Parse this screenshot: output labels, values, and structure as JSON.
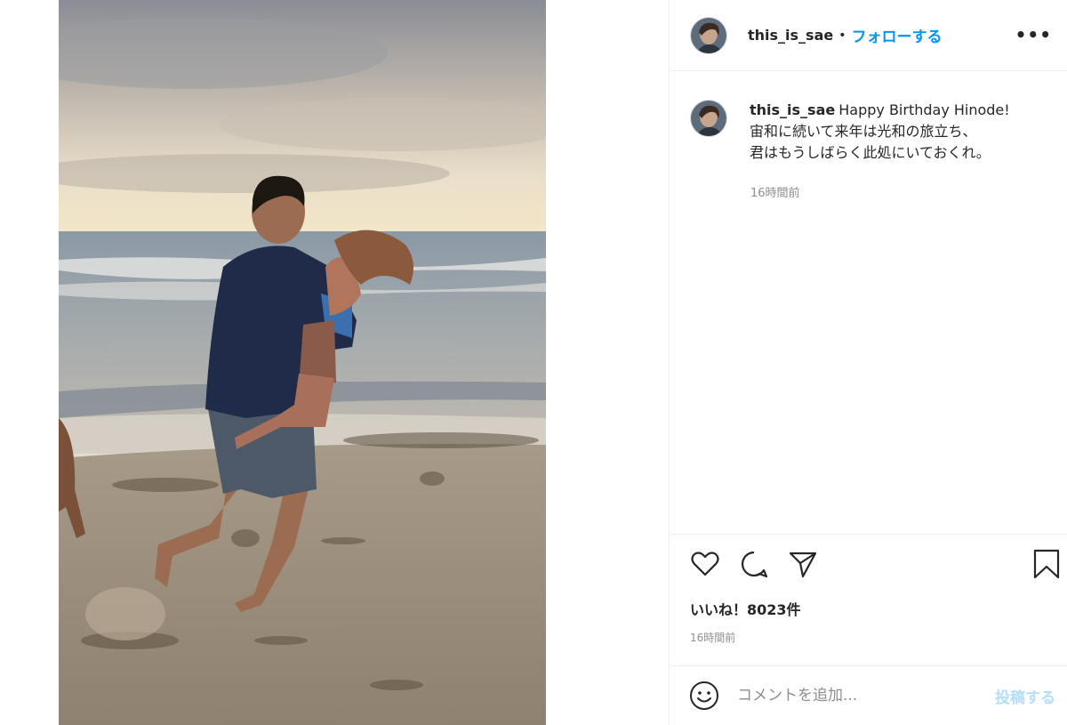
{
  "photo": {
    "alt_icon": "beach-photo"
  },
  "header": {
    "username": "this_is_sae",
    "separator": "•",
    "follow_label": "フォローする",
    "more_icon": "more-icon",
    "more_label": "•••"
  },
  "caption": {
    "username": "this_is_sae",
    "lines": [
      "Happy Birthday Hinode!",
      "宙和に続いて来年は光和の旅立ち、",
      "君はもうしばらく此処にいておくれ。"
    ],
    "time": "16時間前"
  },
  "actions": {
    "icons": [
      "heart-icon",
      "comment-icon",
      "share-icon",
      "bookmark-icon"
    ]
  },
  "likes": "いいね！8023件",
  "post_time": "16時間前",
  "comment": {
    "placeholder": "コメントを追加...",
    "post_label": "投稿する",
    "emoji_icon": "emoji-icon"
  },
  "colors": {
    "accent": "#0095f6",
    "post_disabled": "#b2dffc",
    "muted": "#8e8e8e",
    "border": "#efefef"
  }
}
